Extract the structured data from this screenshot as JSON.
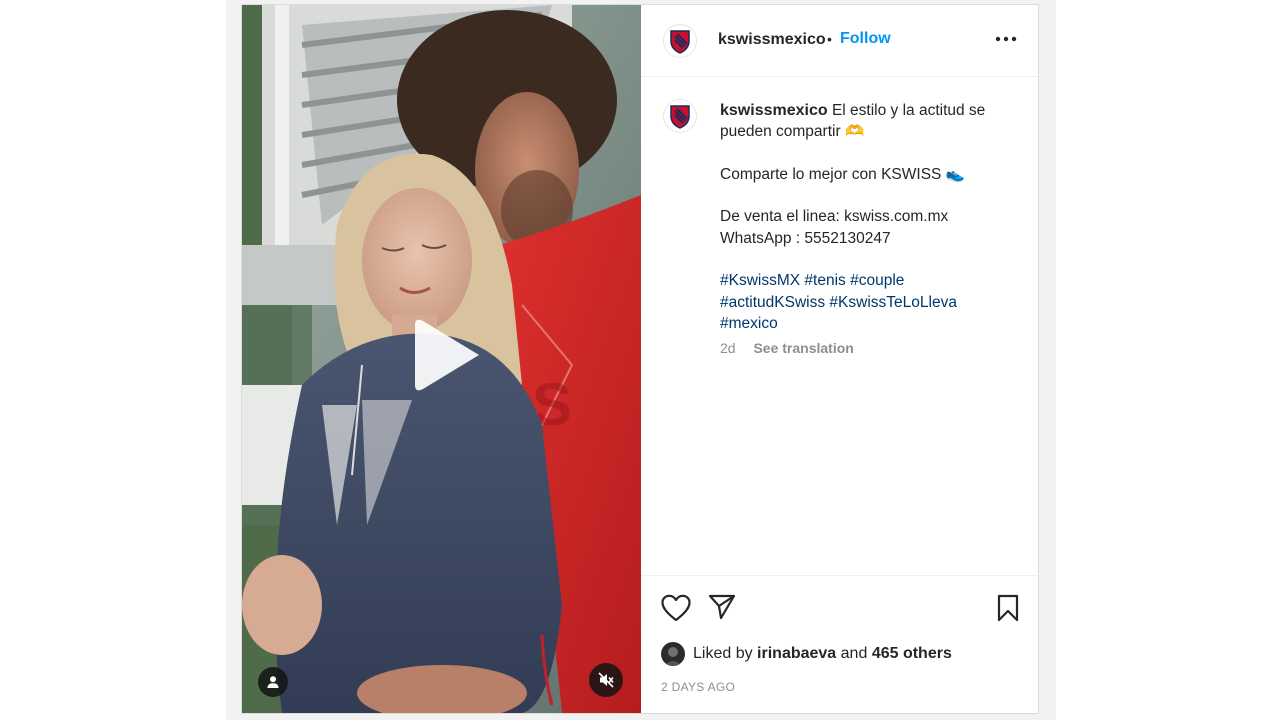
{
  "post": {
    "username": "kswissmexico",
    "separator": "•",
    "follow_label": "Follow",
    "more_icon": "more-options-icon",
    "caption": {
      "line1": "El estilo y la actitud se pueden compartir",
      "emoji1": "🫶",
      "line2": "Comparte lo mejor con KSWISS",
      "emoji2": "👟",
      "line3": "De venta el linea: kswiss.com.mx",
      "line4": "WhatsApp : 5552130247",
      "hashtags": [
        "#KswissMX",
        "#tenis",
        "#couple",
        "#actitudKSwiss",
        "#KswissTeLoLleva",
        "#mexico"
      ]
    },
    "age": "2d",
    "see_translation": "See translation",
    "likes": {
      "prefix": "Liked by",
      "first_liker": "irinabaeva",
      "and": "and",
      "others": "465 others"
    },
    "timestamp": "2 DAYS AGO"
  },
  "media": {
    "type": "video",
    "play_icon": "play-icon",
    "tag_icon": "user-tag-icon",
    "mute_icon": "muted-speaker-icon"
  },
  "colors": {
    "follow": "#0095f6",
    "hashtag": "#00376b",
    "muted_text": "#8e8e8e",
    "brand_red": "#c8102e",
    "brand_navy": "#1c2a5a"
  }
}
